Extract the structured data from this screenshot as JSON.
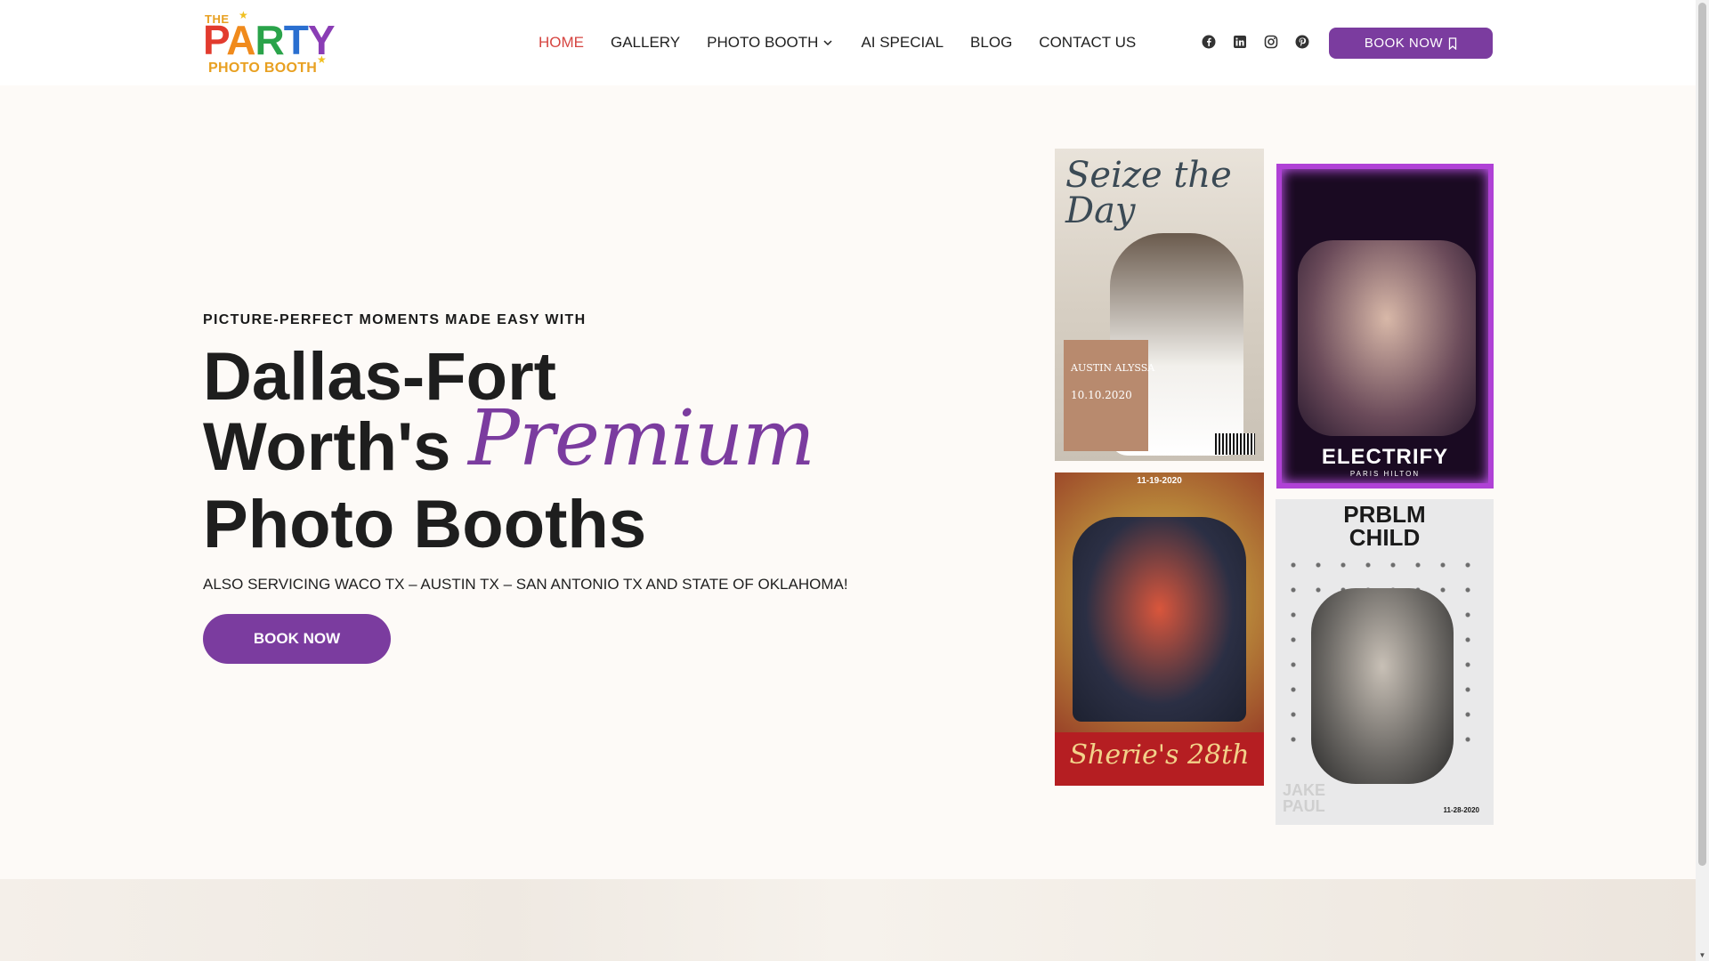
{
  "logo": {
    "line1": "THE",
    "letters": [
      "P",
      "A",
      "R",
      "T",
      "Y"
    ],
    "line3": "PHOTO BOOTH"
  },
  "nav": {
    "items": [
      {
        "label": "HOME",
        "active": true
      },
      {
        "label": "GALLERY",
        "active": false
      },
      {
        "label": "PHOTO BOOTH",
        "active": false,
        "dropdown": true
      },
      {
        "label": "AI SPECIAL",
        "active": false
      },
      {
        "label": "BLOG",
        "active": false
      },
      {
        "label": "CONTACT US",
        "active": false
      }
    ],
    "active_color": "#d64541"
  },
  "social": [
    "facebook-icon",
    "linkedin-icon",
    "instagram-icon",
    "pinterest-icon"
  ],
  "header_button": {
    "label": "BOOK NOW",
    "color": "#7b3c9f"
  },
  "hero": {
    "eyebrow": "PICTURE-PERFECT MOMENTS MADE EASY WITH",
    "line1": "Dallas-Fort",
    "line2": "Worth's",
    "script_word": "Premium",
    "line3": "Photo Booths",
    "subtitle": "ALSO SERVICING WACO TX – AUSTIN TX – SAN ANTONIO TX AND STATE OF OKLAHOMA!",
    "button": "BOOK NOW"
  },
  "photos": {
    "p1": {
      "title": "Seize the Day",
      "names": "AUSTIN ALYSSA",
      "date": "10.10.2020"
    },
    "p2": {
      "brand": "ELECTRIFY",
      "sub": "PARIS HILTON"
    },
    "p3": {
      "date": "11-19-2020",
      "caption": "Sherie's 28th"
    },
    "p4": {
      "brand_line1": "PRBLM",
      "brand_line2": "CHILD",
      "name_line1": "JAKE",
      "name_line2": "PAUL",
      "date": "11-28-2020"
    }
  }
}
